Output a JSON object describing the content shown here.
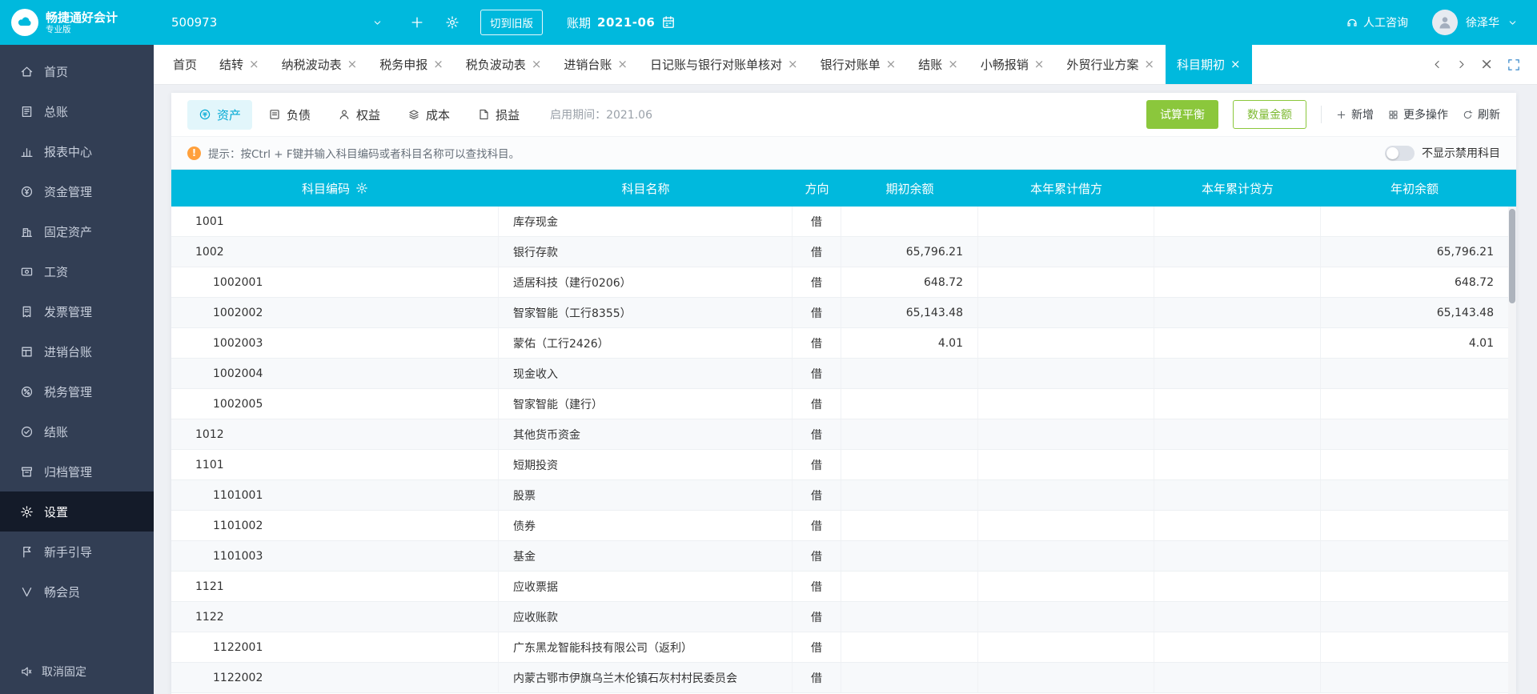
{
  "colors": {
    "accent": "#00b9dd",
    "green": "#8bc73c",
    "sidebar_bg": "#323e54",
    "tip_orange": "#ffa03c"
  },
  "icons": {
    "close_glyph": "×",
    "warning_glyph": "!"
  },
  "topbar": {
    "logo_title": "畅捷通好会计",
    "logo_subtitle": "专业版",
    "company_code": "500973",
    "switch_old_label": "切到旧版",
    "period_label": "账期",
    "period_value": "2021-06",
    "support_label": "人工咨询",
    "user_name": "徐泽华"
  },
  "sidebar": {
    "active_index": 11,
    "unpin_label": "取消固定",
    "items": [
      {
        "label": "首页",
        "icon": "home-icon"
      },
      {
        "label": "总账",
        "icon": "ledger-icon"
      },
      {
        "label": "报表中心",
        "icon": "report-icon"
      },
      {
        "label": "资金管理",
        "icon": "fund-icon"
      },
      {
        "label": "固定资产",
        "icon": "fixed-assets-icon"
      },
      {
        "label": "工资",
        "icon": "payroll-icon"
      },
      {
        "label": "发票管理",
        "icon": "invoice-icon"
      },
      {
        "label": "进销台账",
        "icon": "purchase-sales-icon"
      },
      {
        "label": "税务管理",
        "icon": "tax-icon"
      },
      {
        "label": "结账",
        "icon": "closing-icon"
      },
      {
        "label": "归档管理",
        "icon": "archive-icon"
      },
      {
        "label": "设置",
        "icon": "settings-icon"
      },
      {
        "label": "新手引导",
        "icon": "guide-icon"
      },
      {
        "label": "畅会员",
        "icon": "member-icon"
      }
    ]
  },
  "tabs": {
    "items": [
      {
        "label": "首页",
        "closable": false,
        "active": false
      },
      {
        "label": "结转",
        "closable": true,
        "active": false
      },
      {
        "label": "纳税波动表",
        "closable": true,
        "active": false
      },
      {
        "label": "税务申报",
        "closable": true,
        "active": false
      },
      {
        "label": "税负波动表",
        "closable": true,
        "active": false
      },
      {
        "label": "进销台账",
        "closable": true,
        "active": false
      },
      {
        "label": "日记账与银行对账单核对",
        "closable": true,
        "active": false
      },
      {
        "label": "银行对账单",
        "closable": true,
        "active": false
      },
      {
        "label": "结账",
        "closable": true,
        "active": false
      },
      {
        "label": "小畅报销",
        "closable": true,
        "active": false
      },
      {
        "label": "外贸行业方案",
        "closable": true,
        "active": false
      },
      {
        "label": "科目期初",
        "closable": true,
        "active": true
      }
    ]
  },
  "toolbar": {
    "category_tabs": [
      {
        "label": "资产",
        "icon": "asset-icon",
        "active": true
      },
      {
        "label": "负债",
        "icon": "liability-icon",
        "active": false
      },
      {
        "label": "权益",
        "icon": "equity-icon",
        "active": false
      },
      {
        "label": "成本",
        "icon": "cost-icon",
        "active": false
      },
      {
        "label": "损益",
        "icon": "pnl-icon",
        "active": false
      }
    ],
    "enabled_period": "启用期间：2021.06",
    "trial_balance_label": "试算平衡",
    "qty_amount_label": "数量金额",
    "add_label": "新增",
    "more_label": "更多操作",
    "refresh_label": "刷新"
  },
  "tipbar": {
    "text": "提示：按Ctrl + F键并输入科目编码或者科目名称可以查找科目。",
    "toggle_label": "不显示禁用科目",
    "toggle_on": false
  },
  "table": {
    "columns": [
      {
        "key": "code",
        "label": "科目编码"
      },
      {
        "key": "name",
        "label": "科目名称"
      },
      {
        "key": "dir",
        "label": "方向"
      },
      {
        "key": "opening",
        "label": "期初余额"
      },
      {
        "key": "debit",
        "label": "本年累计借方"
      },
      {
        "key": "credit",
        "label": "本年累计贷方"
      },
      {
        "key": "initial",
        "label": "年初余额"
      }
    ],
    "rows": [
      {
        "code": "1001",
        "name": "库存现金",
        "dir": "借",
        "opening": "",
        "debit": "",
        "credit": "",
        "initial": "",
        "level": 0
      },
      {
        "code": "1002",
        "name": "银行存款",
        "dir": "借",
        "opening": "65,796.21",
        "debit": "",
        "credit": "",
        "initial": "65,796.21",
        "level": 0
      },
      {
        "code": "1002001",
        "name": "适居科技（建行0206）",
        "dir": "借",
        "opening": "648.72",
        "debit": "",
        "credit": "",
        "initial": "648.72",
        "level": 1
      },
      {
        "code": "1002002",
        "name": "智家智能（工行8355）",
        "dir": "借",
        "opening": "65,143.48",
        "debit": "",
        "credit": "",
        "initial": "65,143.48",
        "level": 1
      },
      {
        "code": "1002003",
        "name": "蒙佑（工行2426）",
        "dir": "借",
        "opening": "4.01",
        "debit": "",
        "credit": "",
        "initial": "4.01",
        "level": 1
      },
      {
        "code": "1002004",
        "name": "现金收入",
        "dir": "借",
        "opening": "",
        "debit": "",
        "credit": "",
        "initial": "",
        "level": 1
      },
      {
        "code": "1002005",
        "name": "智家智能（建行）",
        "dir": "借",
        "opening": "",
        "debit": "",
        "credit": "",
        "initial": "",
        "level": 1
      },
      {
        "code": "1012",
        "name": "其他货币资金",
        "dir": "借",
        "opening": "",
        "debit": "",
        "credit": "",
        "initial": "",
        "level": 0
      },
      {
        "code": "1101",
        "name": "短期投资",
        "dir": "借",
        "opening": "",
        "debit": "",
        "credit": "",
        "initial": "",
        "level": 0
      },
      {
        "code": "1101001",
        "name": "股票",
        "dir": "借",
        "opening": "",
        "debit": "",
        "credit": "",
        "initial": "",
        "level": 1
      },
      {
        "code": "1101002",
        "name": "债券",
        "dir": "借",
        "opening": "",
        "debit": "",
        "credit": "",
        "initial": "",
        "level": 1
      },
      {
        "code": "1101003",
        "name": "基金",
        "dir": "借",
        "opening": "",
        "debit": "",
        "credit": "",
        "initial": "",
        "level": 1
      },
      {
        "code": "1121",
        "name": "应收票据",
        "dir": "借",
        "opening": "",
        "debit": "",
        "credit": "",
        "initial": "",
        "level": 0
      },
      {
        "code": "1122",
        "name": "应收账款",
        "dir": "借",
        "opening": "",
        "debit": "",
        "credit": "",
        "initial": "",
        "level": 0
      },
      {
        "code": "1122001",
        "name": "广东黑龙智能科技有限公司（返利）",
        "dir": "借",
        "opening": "",
        "debit": "",
        "credit": "",
        "initial": "",
        "level": 1
      },
      {
        "code": "1122002",
        "name": "内蒙古鄂市伊旗乌兰木伦镇石灰村村民委员会",
        "dir": "借",
        "opening": "",
        "debit": "",
        "credit": "",
        "initial": "",
        "level": 1
      }
    ]
  }
}
